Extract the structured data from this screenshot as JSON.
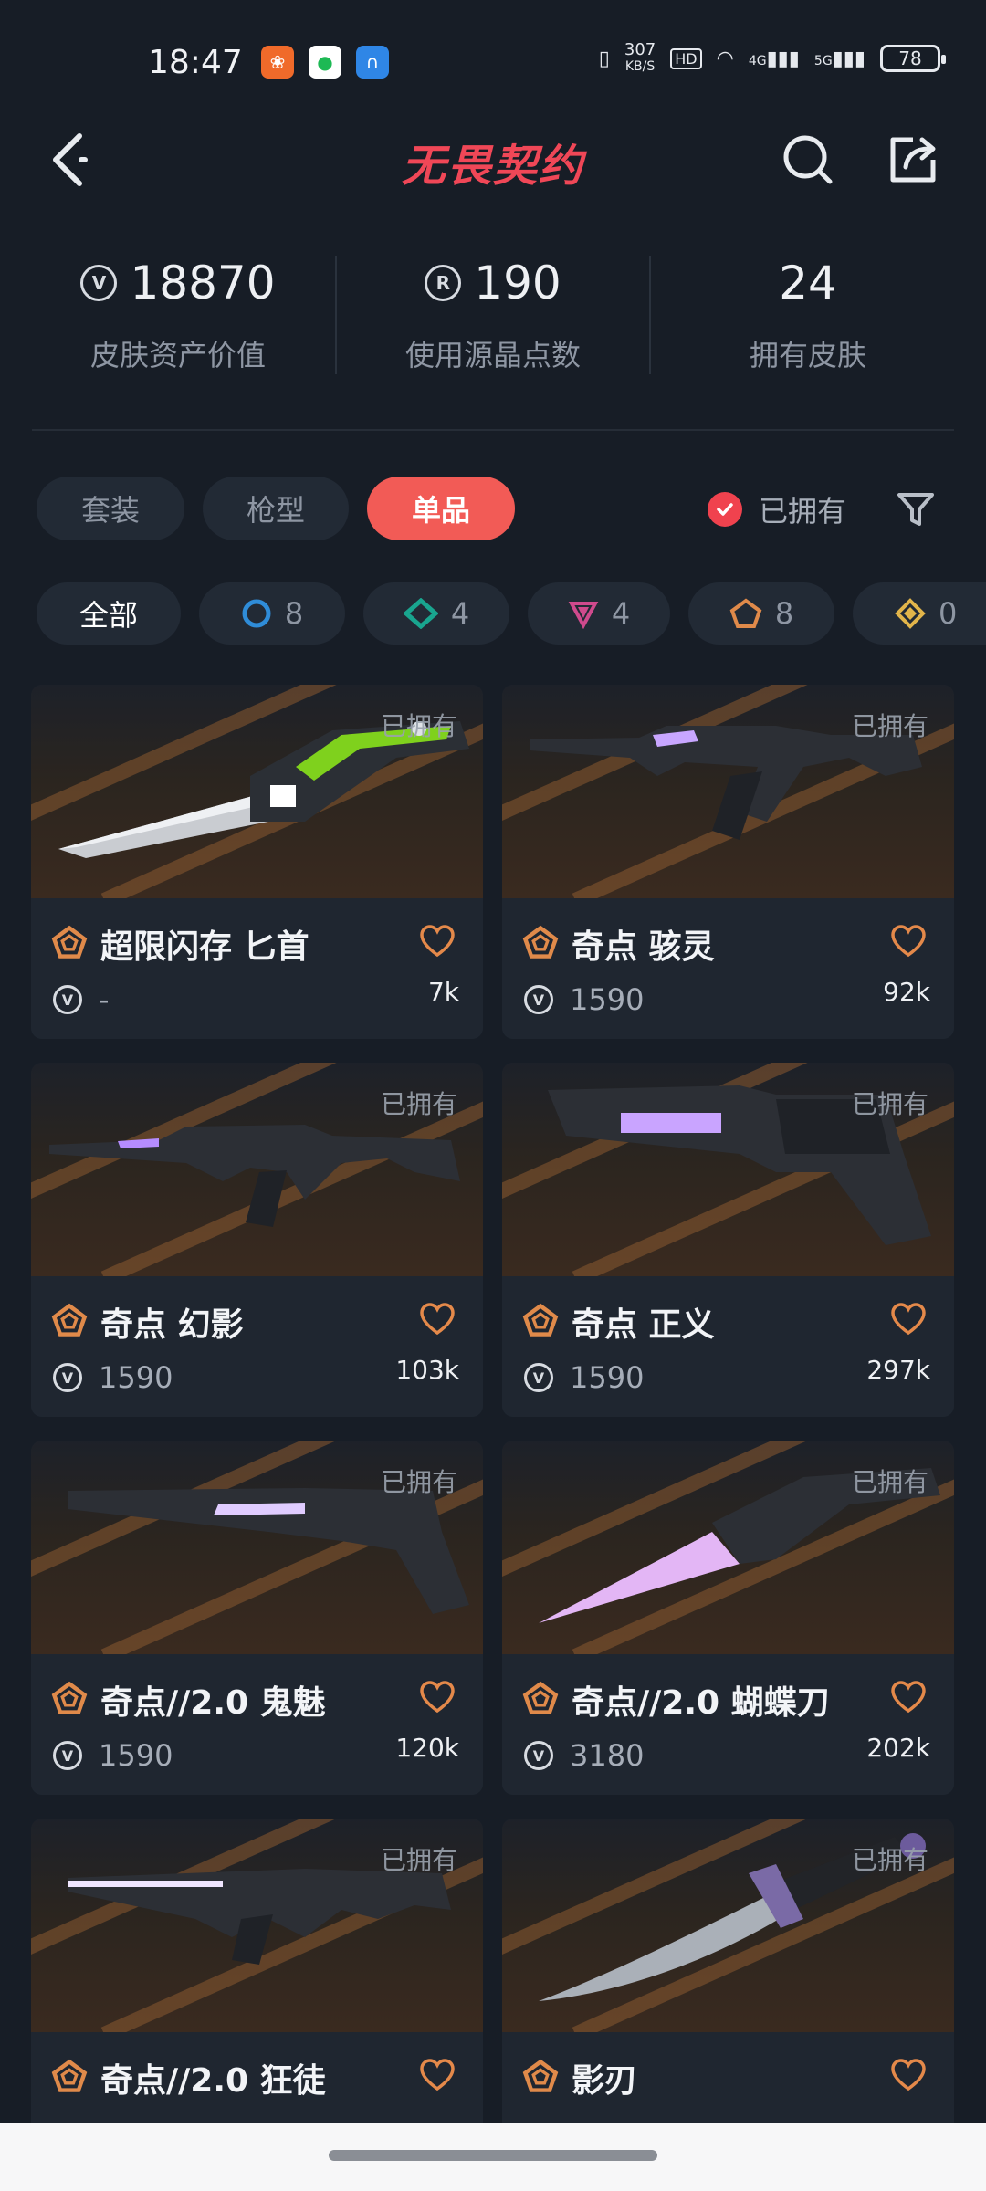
{
  "status_bar": {
    "time": "18:47",
    "net_speed_value": "307",
    "net_speed_unit": "KB/S",
    "hd": "HD",
    "net_4g": "4G",
    "net_5g": "5G",
    "battery": "78"
  },
  "header": {
    "title": "无畏契约"
  },
  "stats": [
    {
      "value": "18870",
      "label": "皮肤资产价值",
      "icon": "valorant-point-icon"
    },
    {
      "value": "190",
      "label": "使用源晶点数",
      "icon": "radianite-icon"
    },
    {
      "value": "24",
      "label": "拥有皮肤",
      "icon": ""
    }
  ],
  "tabs": [
    {
      "label": "套装"
    },
    {
      "label": "枪型"
    },
    {
      "label": "单品"
    }
  ],
  "owned_filter": {
    "label": "已拥有"
  },
  "tier_chips": [
    {
      "label": "全部"
    },
    {
      "count": "8",
      "color": "#2f8cd8",
      "icon": "select-tier-icon"
    },
    {
      "count": "4",
      "color": "#19a58f",
      "icon": "deluxe-tier-icon"
    },
    {
      "count": "4",
      "color": "#d04a8d",
      "icon": "premium-tier-icon"
    },
    {
      "count": "8",
      "color": "#e08a4a",
      "icon": "exclusive-tier-icon"
    },
    {
      "count": "0",
      "color": "#e2b54a",
      "icon": "ultra-tier-icon"
    }
  ],
  "cards": [
    {
      "owned": "已拥有",
      "name": "超限闪存 匕首",
      "price": "-",
      "likes": "7k",
      "weapon": "knife-green"
    },
    {
      "owned": "已拥有",
      "name": "奇点 骇灵",
      "price": "1590",
      "likes": "92k",
      "weapon": "smg"
    },
    {
      "owned": "已拥有",
      "name": "奇点 幻影",
      "price": "1590",
      "likes": "103k",
      "weapon": "rifle"
    },
    {
      "owned": "已拥有",
      "name": "奇点 正义",
      "price": "1590",
      "likes": "297k",
      "weapon": "revolver"
    },
    {
      "owned": "已拥有",
      "name": "奇点//2.0 鬼魅",
      "price": "1590",
      "likes": "120k",
      "weapon": "pistol"
    },
    {
      "owned": "已拥有",
      "name": "奇点//2.0 蝴蝶刀",
      "price": "3180",
      "likes": "202k",
      "weapon": "butterfly"
    },
    {
      "owned": "已拥有",
      "name": "奇点//2.0 狂徒",
      "price": "",
      "likes": "",
      "weapon": "vandal"
    },
    {
      "owned": "已拥有",
      "name": "影刃",
      "price": "",
      "likes": "",
      "weapon": "dagger"
    }
  ],
  "colors": {
    "accent": "#f25b56",
    "tier_exclusive": "#e08a4a",
    "background": "#171d26"
  }
}
